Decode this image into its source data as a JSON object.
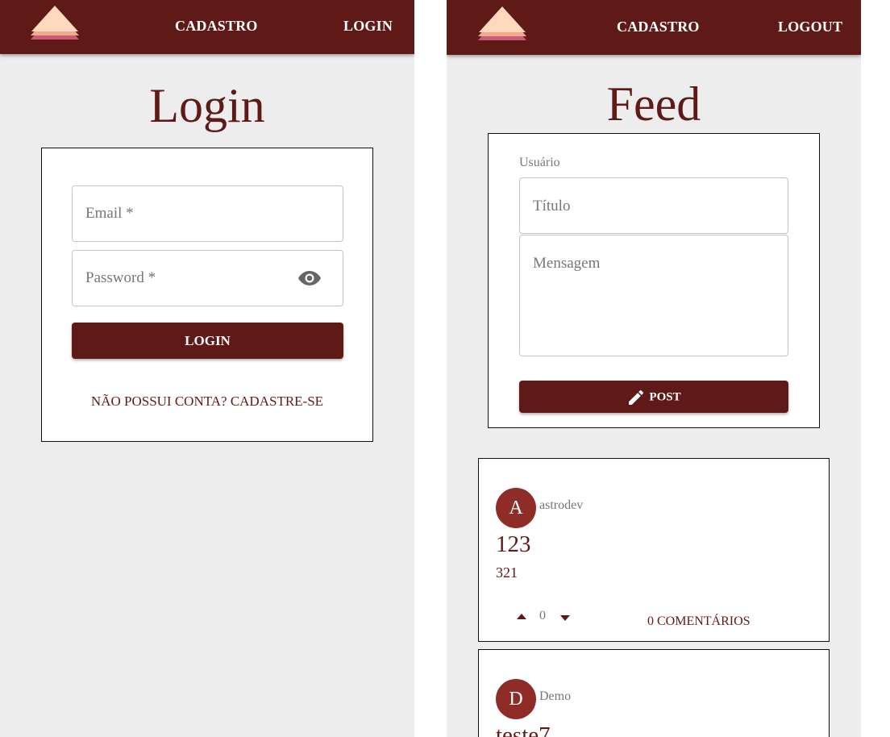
{
  "login_screen": {
    "nav": {
      "cadastro": "CADASTRO",
      "login": "LOGIN"
    },
    "title": "Login",
    "email_label": "Email *",
    "password_label": "Password *",
    "login_button": "LOGIN",
    "signup_link": "NÃO POSSUI CONTA? CADASTRE-SE"
  },
  "feed_screen": {
    "nav": {
      "cadastro": "CADASTRO",
      "logout": "LOGOUT"
    },
    "title": "Feed",
    "form": {
      "user_label": "Usuário",
      "title_placeholder": "Título",
      "message_placeholder": "Mensagem",
      "post_button": "POST"
    },
    "posts": [
      {
        "avatar_letter": "A",
        "username": "astrodev",
        "title": "123",
        "body": "321",
        "votes": "0",
        "comments": "0 COMENTÁRIOS"
      },
      {
        "avatar_letter": "D",
        "username": "Demo",
        "title": "teste7"
      }
    ]
  },
  "icons": {
    "logo": "stacked-triangle-logo",
    "password_toggle": "eye-icon",
    "post": "pencil-icon",
    "upvote": "arrow-up-icon",
    "downvote": "arrow-down-icon"
  },
  "colors": {
    "primary": "#5f1a18",
    "avatar": "#8f2c27",
    "background": "#ededed",
    "logo_top": "#ffd9bd",
    "logo_mid": "#f2a98f",
    "logo_bottom": "#c95b79"
  }
}
